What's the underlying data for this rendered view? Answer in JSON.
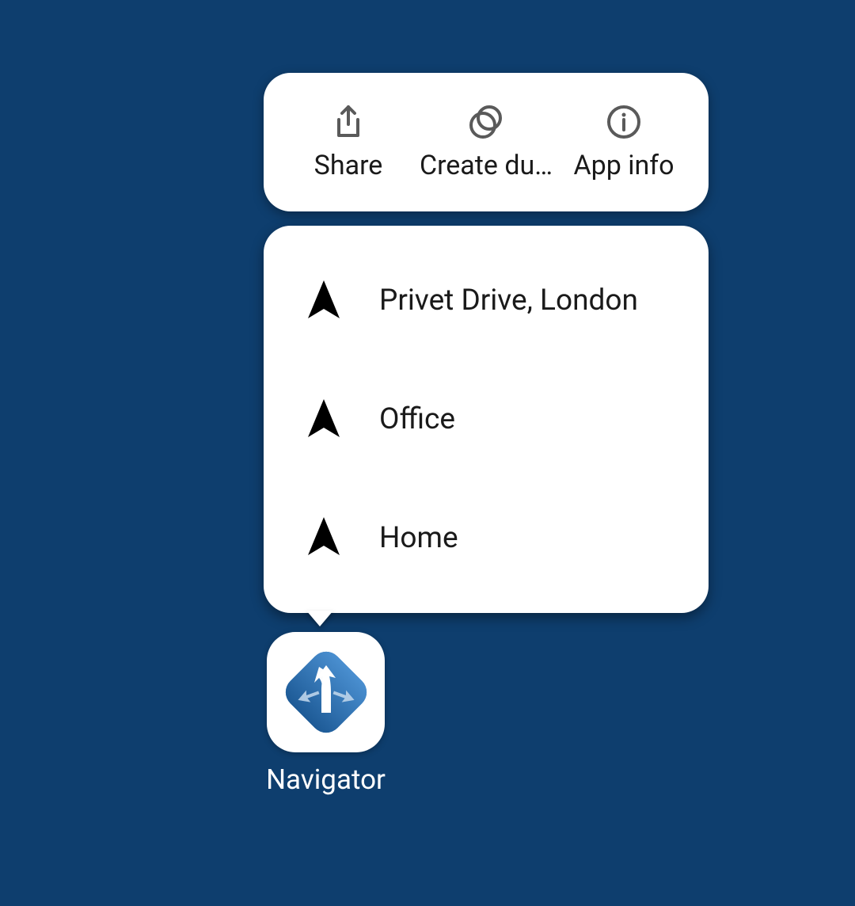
{
  "actions": [
    {
      "name": "share",
      "label": "Share",
      "icon": "share-icon"
    },
    {
      "name": "create-duplicate",
      "label": "Create du…",
      "icon": "duplicate-icon"
    },
    {
      "name": "app-info",
      "label": "App info",
      "icon": "info-icon"
    }
  ],
  "shortcuts": [
    {
      "name": "privet-drive",
      "label": "Privet Drive, London"
    },
    {
      "name": "office",
      "label": "Office"
    },
    {
      "name": "home",
      "label": "Home"
    }
  ],
  "app": {
    "name": "Navigator"
  }
}
